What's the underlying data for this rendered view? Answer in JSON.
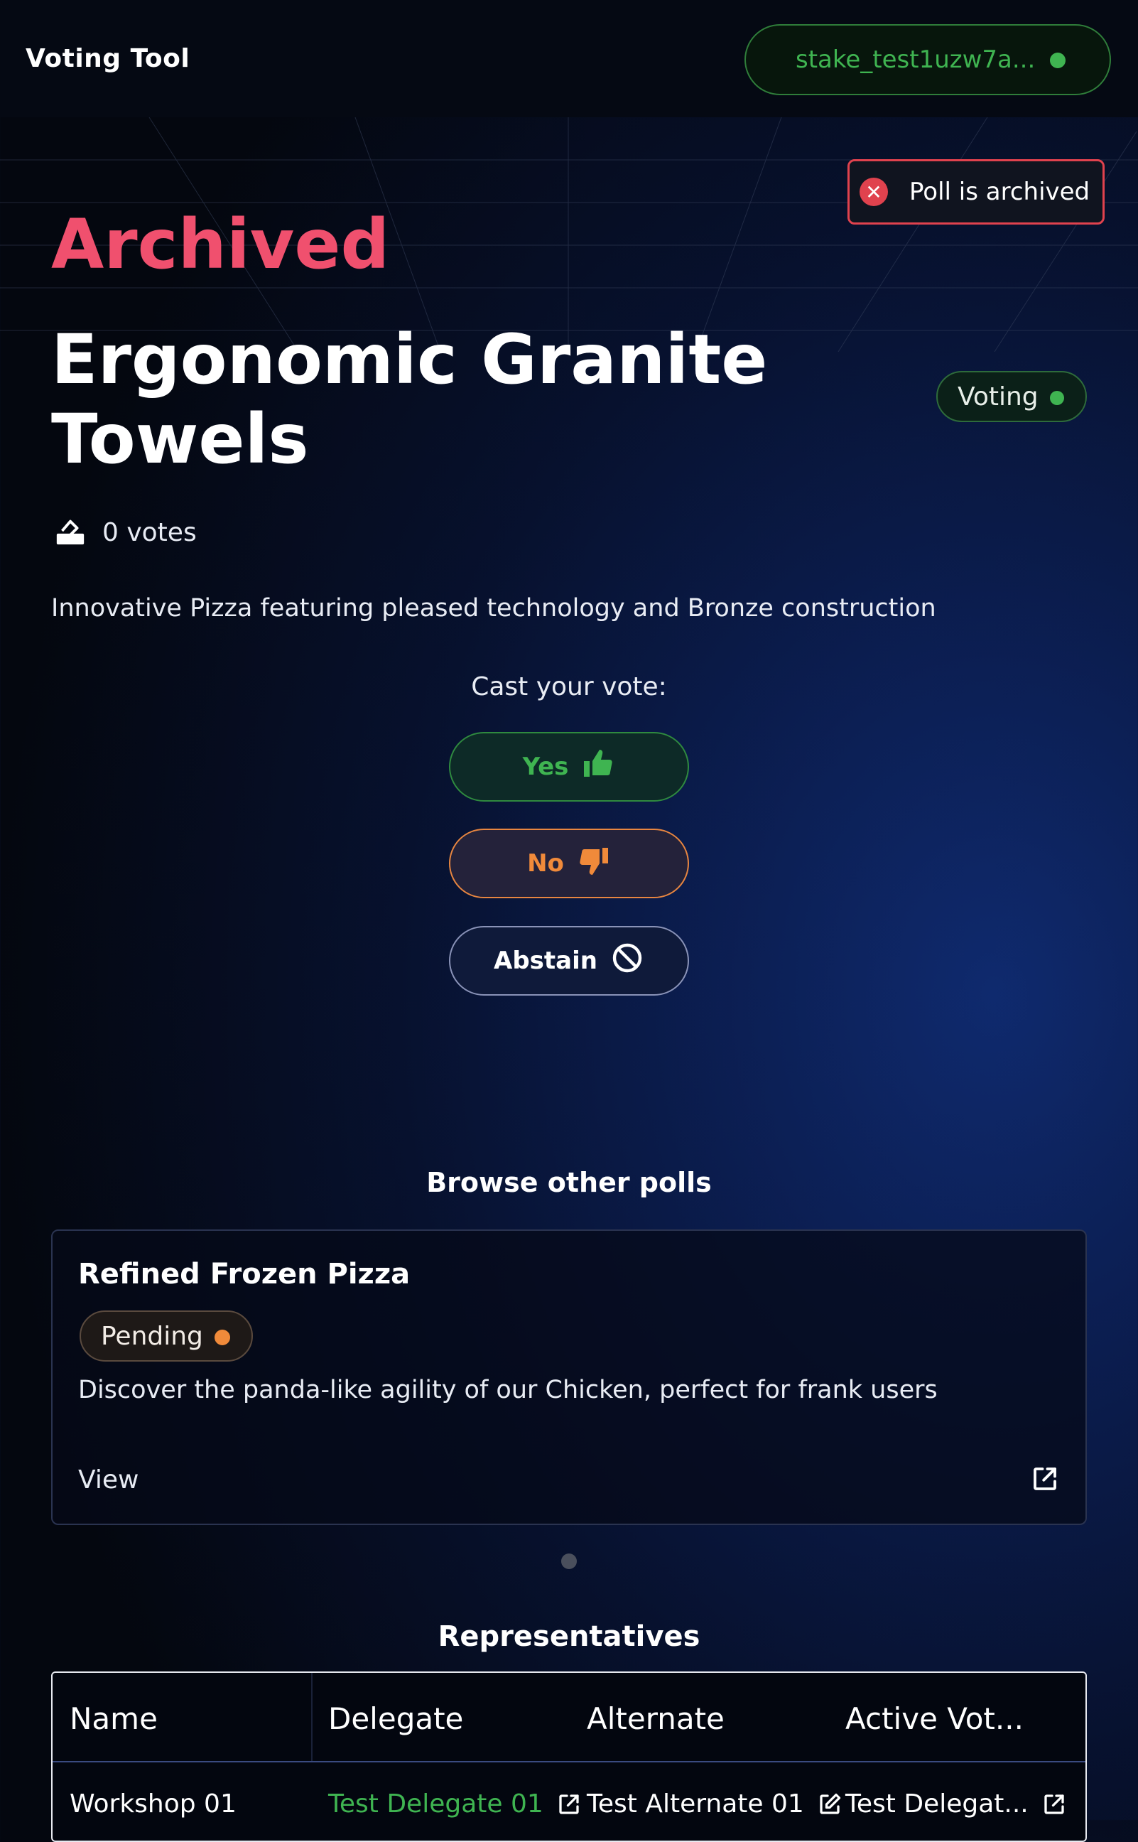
{
  "header": {
    "app_title": "Voting Tool",
    "wallet_address": "stake_test1uzw7a...",
    "wallet_status_color": "#3fb451"
  },
  "toast": {
    "message": "Poll is archived",
    "icon": "close-circle-icon",
    "color": "#e0424e"
  },
  "poll": {
    "status_heading": "Archived",
    "title": "Ergonomic Granite Towels",
    "phase_badge": "Voting",
    "votes_text": "0 votes",
    "description": "Innovative Pizza featuring pleased technology and Bronze construction"
  },
  "vote": {
    "prompt": "Cast your vote:",
    "yes_label": "Yes",
    "no_label": "No",
    "abstain_label": "Abstain"
  },
  "browse": {
    "heading": "Browse other polls",
    "cards": [
      {
        "title": "Refined Frozen Pizza",
        "status": "Pending",
        "status_color": "#f08a3a",
        "description": "Discover the panda-like agility of our Chicken, perfect for frank users",
        "view_label": "View"
      }
    ]
  },
  "representatives": {
    "heading": "Representatives",
    "columns": [
      "Name",
      "Delegate",
      "Alternate",
      "Active Vot..."
    ],
    "rows": [
      {
        "name": "Workshop 01",
        "delegate": "Test Delegate 01",
        "alternate": "Test Alternate 01",
        "active_voter": "Test Delegat..."
      }
    ]
  },
  "colors": {
    "archived_accent": "#f0506e",
    "yes": "#3fb451",
    "no": "#f08a3a"
  }
}
